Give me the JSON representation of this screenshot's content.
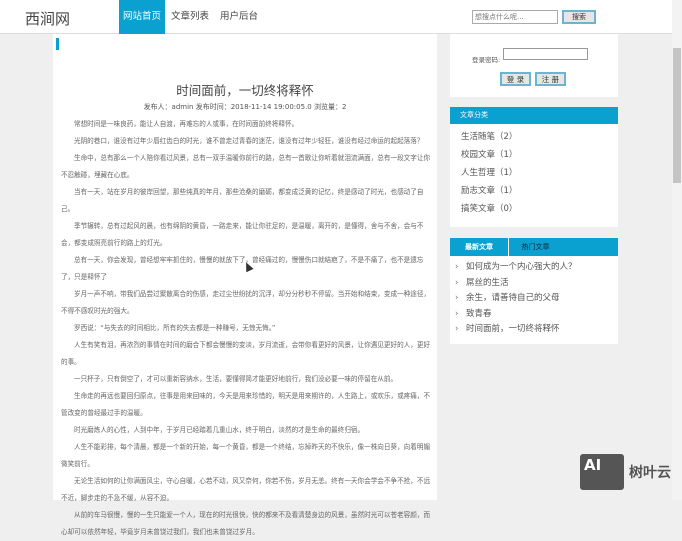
{
  "header": {
    "logo": "西涧网",
    "nav": [
      "网站首页",
      "文章列表",
      "用户后台"
    ],
    "search_placeholder": "想搜点什么呢...",
    "search_button": "搜索"
  },
  "article": {
    "title": "时间面前，一切终将释怀",
    "meta": "发布人：admin  发布时间：2018-11-14 19:00:05.0  浏览量：2",
    "paragraphs": [
      "常想时间是一味良药，能让人自渡，再难忘的人或事，在时间面前终将释怀。",
      "光阴的巷口，谁没有过年少唇红齿白的时光，谁不曾走过青春的迷茫，谁没有过年少轻狂，谁没有经过命运的起起落落？",
      "生命中，总有那么一个人陪你看过风景，总有一双手温暖你前行的路，总有一首歌让你听着就泪流满面，总有一段文字让你不忍触碰，埋藏在心底。",
      "当有一天，站在岁月的彼岸回望，那些纯真的年月，那些沧桑的磨砺，都变成泛黄的记忆，终是感动了时光，也感动了自己。",
      "季节辗转，总有过起风的晨，也有绵阴的黄昏，一路走来，能让你驻足的，是温暖，离开的，是懂得，舍与不舍，会与不会，都变成照亮前行的路上的灯光。",
      "总有一天，你会发现，曾经想牢牢抓住的，慢慢的就放下了，曾经痛过的，慢慢伤口就结疤了，不是不痛了，也不是遗忘了，只是释怀了",
      "岁月一声不响，带我们品尝过聚散离合的伤感，走过尘世纷扰的沉浮，却分分秒秒不停留。当开始和结束，变成一种途径，不得不感叹时光的强大。",
      "罗西说：“与失去的时间相比，所有的失去都是一种赚号，无惊无悔。”",
      "人生有笑有泪，再浓烈的事情在时间的磨合下都会慢慢的变淡，岁月流逝，会带你看更好的风景，让你遇见更好的人，更好的事。",
      "一只杯子，只有倒空了，才可以重新容纳水，生活，要懂得简才能更好地前行，我们没必要一味的停留在从前。",
      "生命走的再远也要回归原点，往事是用来回味的，今天是用来珍惜的，明天是用来期许的，人生路上，或欢乐，或疼痛，不管改变的曾经最过手的温暖。",
      "时光磨炼人的心性，人到中年，于岁月已经踏着几重山水，终于明白，淡然的才是生命的最终归宿。",
      "人生不能彩排，每个清晨，都是一个新的开始，每一个黄昏，都是一个终结，忘掉昨天的不快乐，像一株向日葵，向着明媚微笑前行。",
      "无论生活如何的让你满面风尘，守心自暖，心若不动，风又奈何，你若不伤，岁月无恙。终有一天你会学会不争不抢，不远不近，脚步走的不急不缓，从容不迫。",
      "从前的车马很慢，慢的一生只能爱一个人，现在的时光很快，快的都来不及看清楚身边的风景，虽然时光可以苍老容颜，而心却可以依然年轻，毕竟岁月未曾饶过我们，我们也未曾饶过岁月。"
    ]
  },
  "login": {
    "password_label": "登录密码:",
    "login_button": "登 录",
    "register_button": "注 册"
  },
  "categories": {
    "title": "文章分类",
    "items": [
      "生活随笔（2）",
      "校园文章（1）",
      "人生哲理（1）",
      "励志文章（1）",
      "搞笑文章（0）"
    ]
  },
  "recent": {
    "tabs": [
      "最新文章",
      "热门文章"
    ],
    "items": [
      "如何成为一个内心强大的人？",
      "屌丝的生活",
      "余生，请善待自己的父母",
      "致青春",
      "时间面前，一切终将释怀"
    ]
  },
  "watermark": {
    "logo": "AI",
    "text": "树叶云"
  }
}
